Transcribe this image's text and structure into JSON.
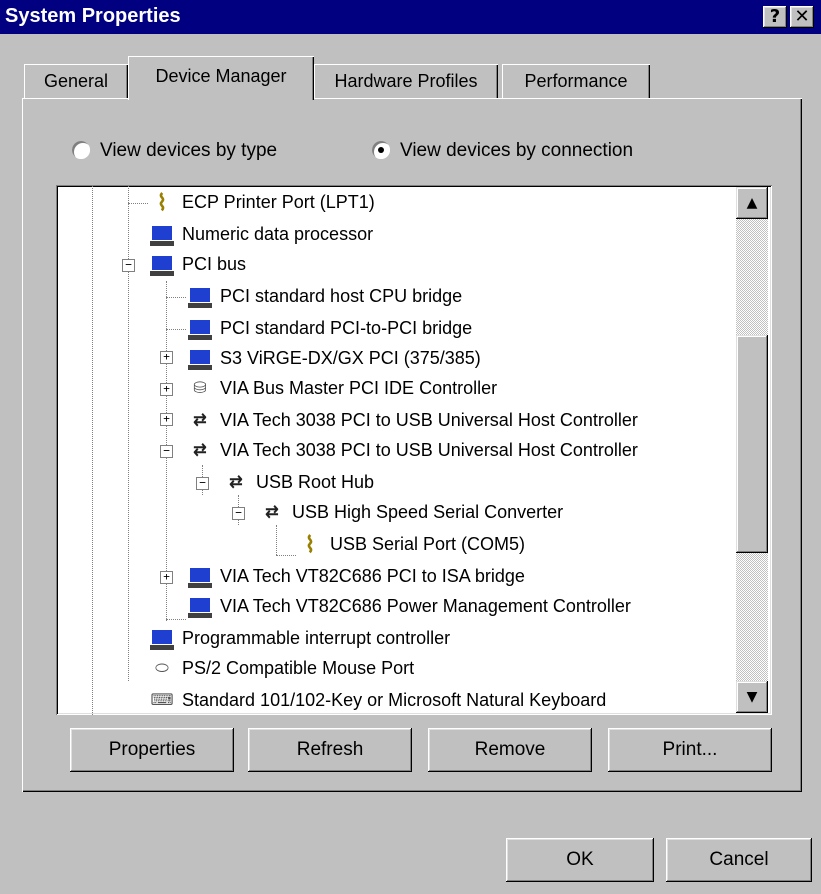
{
  "window": {
    "title": "System Properties",
    "help_label": "?",
    "close_label": "✕"
  },
  "tabs": [
    {
      "label": "General"
    },
    {
      "label": "Device Manager"
    },
    {
      "label": "Hardware Profiles"
    },
    {
      "label": "Performance"
    }
  ],
  "view_options": {
    "by_type": "View devices by type",
    "by_connection": "View devices by connection",
    "selected": "by_connection"
  },
  "tree": {
    "items": [
      {
        "label": "ECP Printer Port (LPT1)",
        "icon": "port-icon"
      },
      {
        "label": "Numeric data processor",
        "icon": "computer-icon"
      },
      {
        "label": "PCI bus",
        "icon": "computer-icon"
      },
      {
        "label": "PCI standard host CPU bridge",
        "icon": "computer-icon"
      },
      {
        "label": "PCI standard PCI-to-PCI bridge",
        "icon": "computer-icon"
      },
      {
        "label": "S3 ViRGE-DX/GX PCI (375/385)",
        "icon": "computer-icon"
      },
      {
        "label": "VIA Bus Master PCI IDE Controller",
        "icon": "disk-controller-icon"
      },
      {
        "label": "VIA Tech 3038 PCI to USB Universal Host Controller",
        "icon": "usb-icon"
      },
      {
        "label": "VIA Tech 3038 PCI to USB Universal Host Controller",
        "icon": "usb-icon"
      },
      {
        "label": "USB Root Hub",
        "icon": "usb-icon"
      },
      {
        "label": "USB High Speed Serial Converter",
        "icon": "usb-icon"
      },
      {
        "label": "USB Serial Port (COM5)",
        "icon": "port-icon"
      },
      {
        "label": "VIA Tech VT82C686 PCI to ISA bridge",
        "icon": "computer-icon"
      },
      {
        "label": "VIA Tech VT82C686 Power Management Controller",
        "icon": "computer-icon"
      },
      {
        "label": "Programmable interrupt controller",
        "icon": "computer-icon"
      },
      {
        "label": "PS/2 Compatible Mouse Port",
        "icon": "mouse-icon"
      },
      {
        "label": "Standard 101/102-Key or Microsoft Natural Keyboard",
        "icon": "keyboard-icon"
      }
    ]
  },
  "buttons": {
    "properties": "Properties",
    "refresh": "Refresh",
    "remove": "Remove",
    "print": "Print...",
    "ok": "OK",
    "cancel": "Cancel"
  },
  "scrollbar": {
    "up_arrow": "▲",
    "down_arrow": "▼"
  },
  "colors": {
    "titlebar": "#000080",
    "face": "#c0c0c0",
    "tree_background": "#ffffff"
  }
}
